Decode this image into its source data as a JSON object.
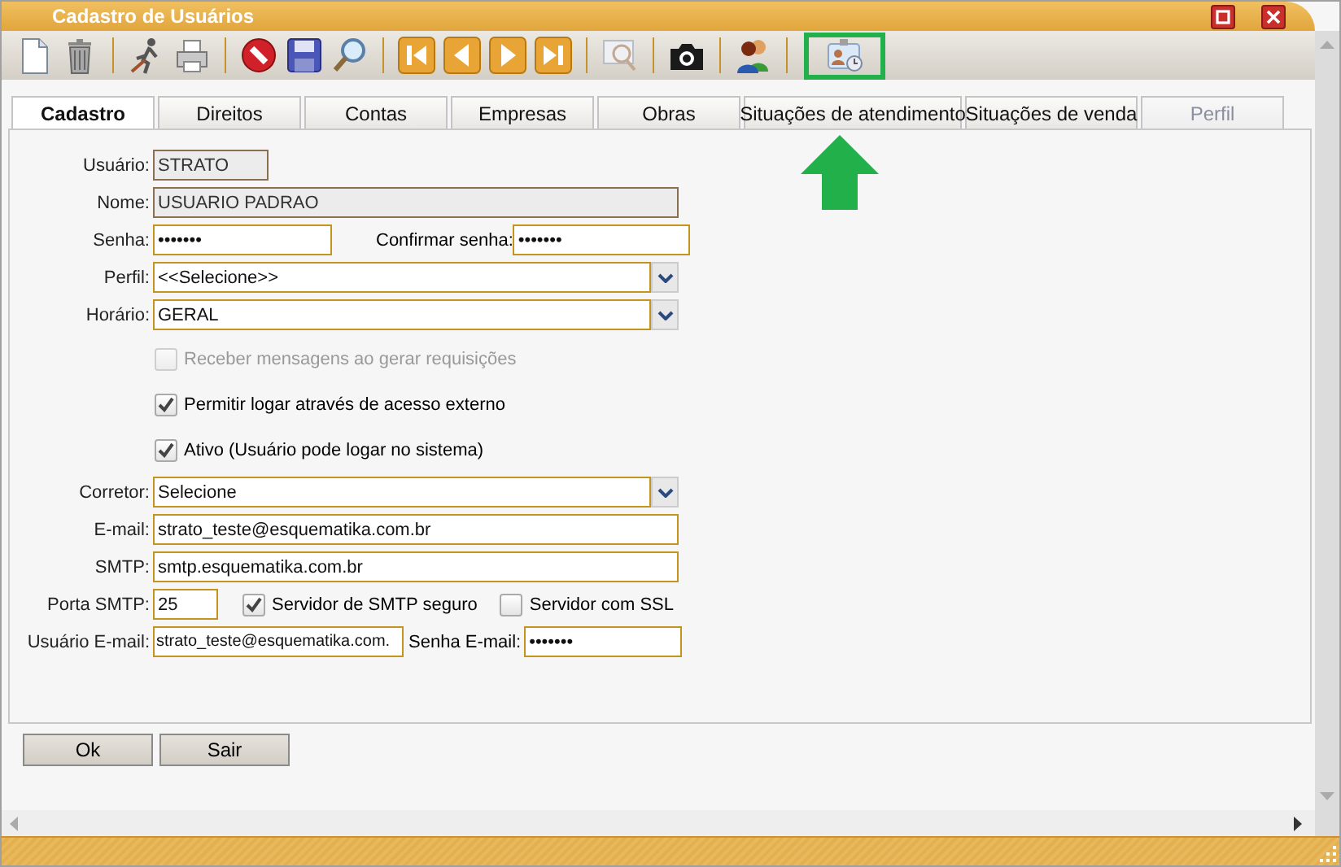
{
  "window": {
    "title": "Cadastro de Usuários"
  },
  "tabs": [
    {
      "label": "Cadastro",
      "selected": true,
      "disabled": false
    },
    {
      "label": "Direitos",
      "selected": false,
      "disabled": false
    },
    {
      "label": "Contas",
      "selected": false,
      "disabled": false
    },
    {
      "label": "Empresas",
      "selected": false,
      "disabled": false
    },
    {
      "label": "Obras",
      "selected": false,
      "disabled": false
    },
    {
      "label": "Situações de atendimento",
      "selected": false,
      "disabled": false
    },
    {
      "label": "Situações de venda",
      "selected": false,
      "disabled": false
    },
    {
      "label": "Perfil",
      "selected": false,
      "disabled": true
    }
  ],
  "form": [
    {
      "kind": "short",
      "label": "Usuário:",
      "value": "STRATO",
      "readonly": true
    },
    {
      "kind": "field",
      "label": "Nome:",
      "value": "USUARIO PADRAO",
      "readonly": true
    },
    {
      "kind": "pair",
      "label": "Senha:",
      "value": "•••••••",
      "label2": "Confirmar senha:",
      "value2": "•••••••"
    },
    {
      "kind": "select",
      "label": "Perfil:",
      "value": "<<Selecione>>"
    },
    {
      "kind": "select",
      "label": "Horário:",
      "value": "GERAL"
    },
    {
      "kind": "checkbox",
      "label": "Receber mensagens ao gerar requisições",
      "checked": false,
      "disabled": true
    },
    {
      "kind": "checkbox",
      "label": "Permitir logar através de acesso externo",
      "checked": true,
      "disabled": false
    },
    {
      "kind": "checkbox",
      "label": "Ativo (Usuário pode logar no sistema)",
      "checked": true,
      "disabled": false
    },
    {
      "kind": "select",
      "label": "Corretor:",
      "value": "Selecione"
    },
    {
      "kind": "field",
      "label": "E-mail:",
      "value": "strato_teste@esquematika.com.br",
      "readonly": false
    },
    {
      "kind": "field",
      "label": "SMTP:",
      "value": "smtp.esquematika.com.br",
      "readonly": false
    },
    {
      "kind": "port",
      "label": "Porta SMTP:",
      "value": "25",
      "options": [
        {
          "label": "Servidor de SMTP seguro",
          "checked": true
        },
        {
          "label": "Servidor com SSL",
          "checked": false
        }
      ]
    },
    {
      "kind": "login",
      "label": "Usuário E-mail:",
      "value": "strato_teste@esquematika.com.",
      "label2": "Senha E-mail:",
      "value2": "•••••••"
    }
  ],
  "buttons": [
    "Ok",
    "Sair"
  ]
}
